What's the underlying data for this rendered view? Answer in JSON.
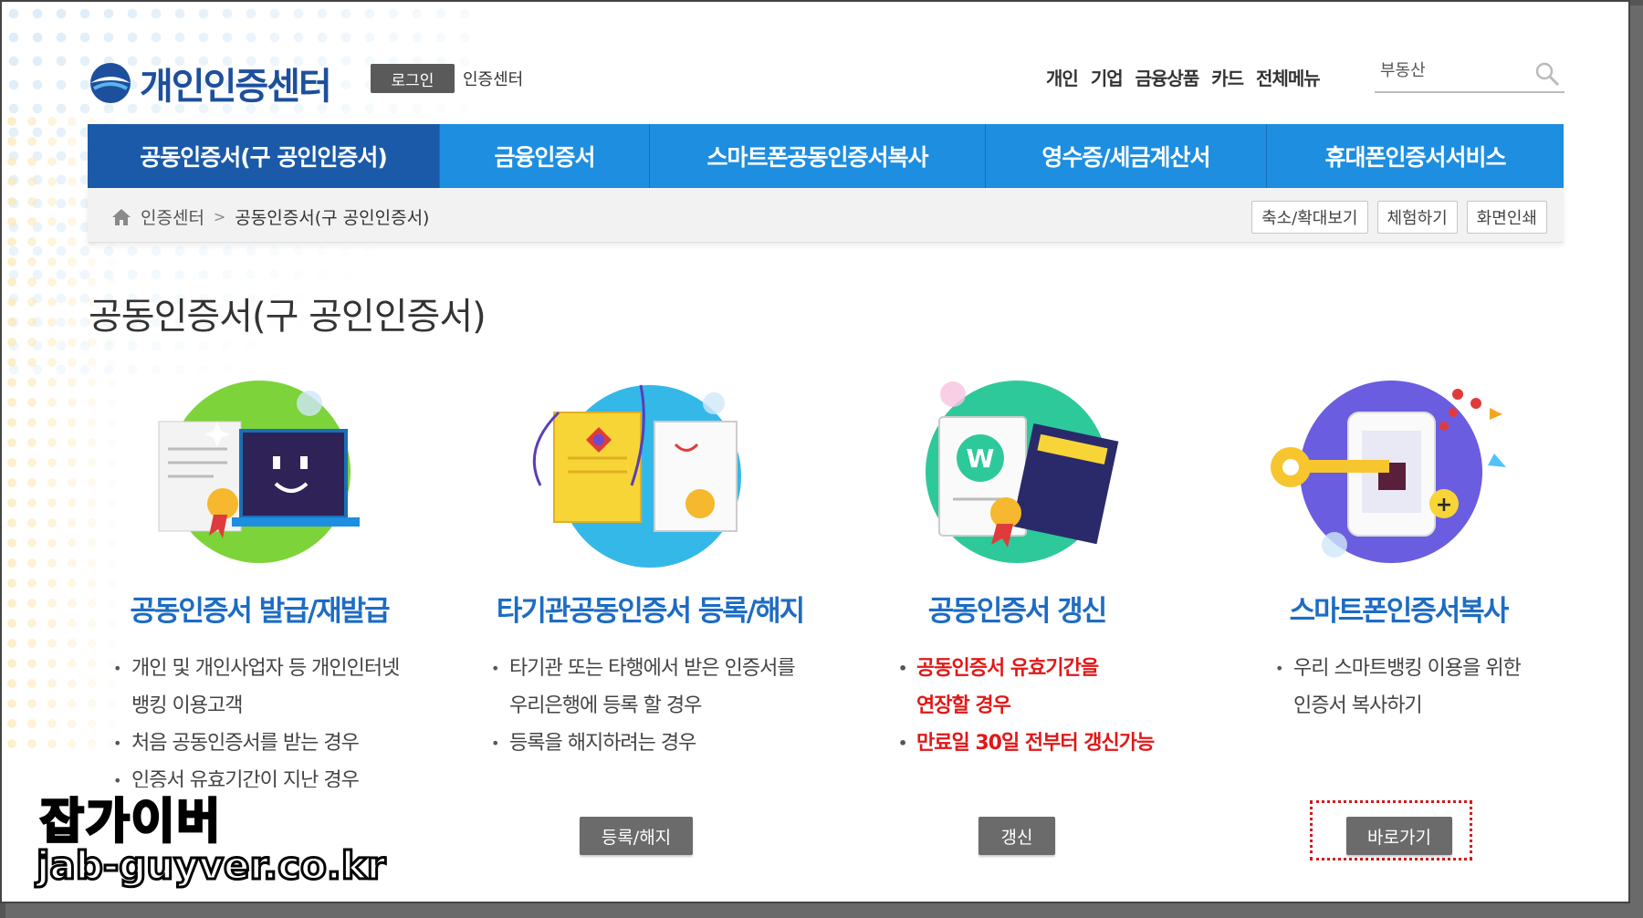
{
  "header": {
    "logo_text": "개인인증센터",
    "login_label": "로그인",
    "center_label": "인증센터",
    "top_links": [
      "개인",
      "기업",
      "금융상품",
      "카드",
      "전체메뉴"
    ],
    "search_value": "부동산"
  },
  "nav": {
    "tabs": [
      {
        "label": "공동인증서(구 공인인증서)",
        "active": true
      },
      {
        "label": "금융인증서",
        "active": false
      },
      {
        "label": "스마트폰공동인증서복사",
        "active": false
      },
      {
        "label": "영수증/세금계산서",
        "active": false
      },
      {
        "label": "휴대폰인증서서비스",
        "active": false
      }
    ]
  },
  "breadcrumb": {
    "items": [
      "인증센터",
      "공동인증서(구 공인인증서)"
    ],
    "tools": [
      "축소/확대보기",
      "체험하기",
      "화면인쇄"
    ]
  },
  "page": {
    "title": "공동인증서(구 공인인증서)"
  },
  "cards": [
    {
      "title": "공동인증서 발급/재발급",
      "bullets": [
        {
          "line1": "개인 및 개인사업자 등 개인인터넷",
          "line2": "뱅킹 이용고객"
        },
        {
          "line1": "처음 공동인증서를 받는 경우",
          "line2": ""
        },
        {
          "line1": "인증서 유효기간이 지난 경우",
          "line2": ""
        }
      ],
      "button": ""
    },
    {
      "title": "타기관공동인증서 등록/해지",
      "bullets": [
        {
          "line1": "타기관 또는 타행에서 받은 인증서를",
          "line2": "우리은행에 등록 할 경우"
        },
        {
          "line1": "등록을 해지하려는 경우",
          "line2": ""
        }
      ],
      "button": "등록/해지"
    },
    {
      "title": "공동인증서 갱신",
      "bullets": [
        {
          "line1": "공동인증서 유효기간을",
          "line2": "연장할 경우"
        },
        {
          "line1": "만료일 30일 전부터 갱신가능",
          "line2": ""
        }
      ],
      "button": "갱신"
    },
    {
      "title": "스마트폰인증서복사",
      "bullets": [
        {
          "line1": "우리 스마트뱅킹 이용을 위한",
          "line2": "인증서 복사하기"
        }
      ],
      "button": "바로가기"
    }
  ],
  "watermark": {
    "line1": "잡가이버",
    "line2": "jab-guyver.co.kr"
  },
  "colors": {
    "nav_blue": "#1d8ee0",
    "nav_active": "#1b5aa8",
    "title_blue": "#1d6cc4",
    "alert_red": "#e01818"
  },
  "icons": [
    "search-icon",
    "home-icon",
    "logo-mark-icon"
  ]
}
